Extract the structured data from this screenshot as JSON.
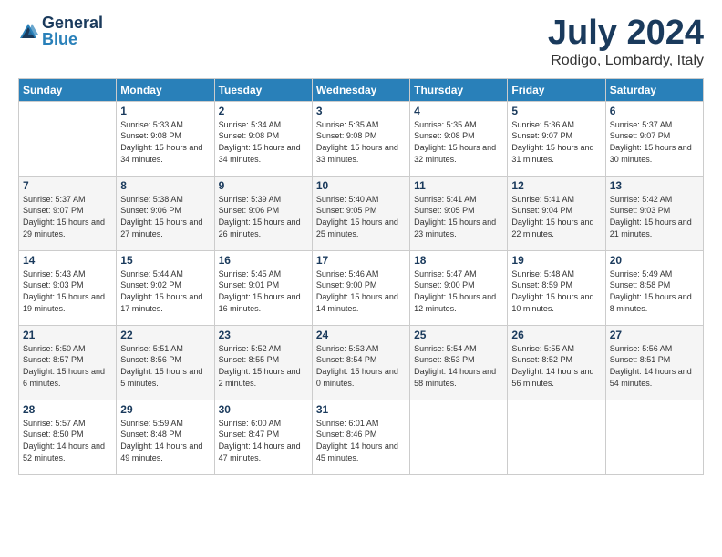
{
  "logo": {
    "general": "General",
    "blue": "Blue"
  },
  "header": {
    "title": "July 2024",
    "subtitle": "Rodigo, Lombardy, Italy"
  },
  "days_of_week": [
    "Sunday",
    "Monday",
    "Tuesday",
    "Wednesday",
    "Thursday",
    "Friday",
    "Saturday"
  ],
  "weeks": [
    [
      {
        "day": "",
        "sunrise": "",
        "sunset": "",
        "daylight": ""
      },
      {
        "day": "1",
        "sunrise": "Sunrise: 5:33 AM",
        "sunset": "Sunset: 9:08 PM",
        "daylight": "Daylight: 15 hours and 34 minutes."
      },
      {
        "day": "2",
        "sunrise": "Sunrise: 5:34 AM",
        "sunset": "Sunset: 9:08 PM",
        "daylight": "Daylight: 15 hours and 34 minutes."
      },
      {
        "day": "3",
        "sunrise": "Sunrise: 5:35 AM",
        "sunset": "Sunset: 9:08 PM",
        "daylight": "Daylight: 15 hours and 33 minutes."
      },
      {
        "day": "4",
        "sunrise": "Sunrise: 5:35 AM",
        "sunset": "Sunset: 9:08 PM",
        "daylight": "Daylight: 15 hours and 32 minutes."
      },
      {
        "day": "5",
        "sunrise": "Sunrise: 5:36 AM",
        "sunset": "Sunset: 9:07 PM",
        "daylight": "Daylight: 15 hours and 31 minutes."
      },
      {
        "day": "6",
        "sunrise": "Sunrise: 5:37 AM",
        "sunset": "Sunset: 9:07 PM",
        "daylight": "Daylight: 15 hours and 30 minutes."
      }
    ],
    [
      {
        "day": "7",
        "sunrise": "Sunrise: 5:37 AM",
        "sunset": "Sunset: 9:07 PM",
        "daylight": "Daylight: 15 hours and 29 minutes."
      },
      {
        "day": "8",
        "sunrise": "Sunrise: 5:38 AM",
        "sunset": "Sunset: 9:06 PM",
        "daylight": "Daylight: 15 hours and 27 minutes."
      },
      {
        "day": "9",
        "sunrise": "Sunrise: 5:39 AM",
        "sunset": "Sunset: 9:06 PM",
        "daylight": "Daylight: 15 hours and 26 minutes."
      },
      {
        "day": "10",
        "sunrise": "Sunrise: 5:40 AM",
        "sunset": "Sunset: 9:05 PM",
        "daylight": "Daylight: 15 hours and 25 minutes."
      },
      {
        "day": "11",
        "sunrise": "Sunrise: 5:41 AM",
        "sunset": "Sunset: 9:05 PM",
        "daylight": "Daylight: 15 hours and 23 minutes."
      },
      {
        "day": "12",
        "sunrise": "Sunrise: 5:41 AM",
        "sunset": "Sunset: 9:04 PM",
        "daylight": "Daylight: 15 hours and 22 minutes."
      },
      {
        "day": "13",
        "sunrise": "Sunrise: 5:42 AM",
        "sunset": "Sunset: 9:03 PM",
        "daylight": "Daylight: 15 hours and 21 minutes."
      }
    ],
    [
      {
        "day": "14",
        "sunrise": "Sunrise: 5:43 AM",
        "sunset": "Sunset: 9:03 PM",
        "daylight": "Daylight: 15 hours and 19 minutes."
      },
      {
        "day": "15",
        "sunrise": "Sunrise: 5:44 AM",
        "sunset": "Sunset: 9:02 PM",
        "daylight": "Daylight: 15 hours and 17 minutes."
      },
      {
        "day": "16",
        "sunrise": "Sunrise: 5:45 AM",
        "sunset": "Sunset: 9:01 PM",
        "daylight": "Daylight: 15 hours and 16 minutes."
      },
      {
        "day": "17",
        "sunrise": "Sunrise: 5:46 AM",
        "sunset": "Sunset: 9:00 PM",
        "daylight": "Daylight: 15 hours and 14 minutes."
      },
      {
        "day": "18",
        "sunrise": "Sunrise: 5:47 AM",
        "sunset": "Sunset: 9:00 PM",
        "daylight": "Daylight: 15 hours and 12 minutes."
      },
      {
        "day": "19",
        "sunrise": "Sunrise: 5:48 AM",
        "sunset": "Sunset: 8:59 PM",
        "daylight": "Daylight: 15 hours and 10 minutes."
      },
      {
        "day": "20",
        "sunrise": "Sunrise: 5:49 AM",
        "sunset": "Sunset: 8:58 PM",
        "daylight": "Daylight: 15 hours and 8 minutes."
      }
    ],
    [
      {
        "day": "21",
        "sunrise": "Sunrise: 5:50 AM",
        "sunset": "Sunset: 8:57 PM",
        "daylight": "Daylight: 15 hours and 6 minutes."
      },
      {
        "day": "22",
        "sunrise": "Sunrise: 5:51 AM",
        "sunset": "Sunset: 8:56 PM",
        "daylight": "Daylight: 15 hours and 5 minutes."
      },
      {
        "day": "23",
        "sunrise": "Sunrise: 5:52 AM",
        "sunset": "Sunset: 8:55 PM",
        "daylight": "Daylight: 15 hours and 2 minutes."
      },
      {
        "day": "24",
        "sunrise": "Sunrise: 5:53 AM",
        "sunset": "Sunset: 8:54 PM",
        "daylight": "Daylight: 15 hours and 0 minutes."
      },
      {
        "day": "25",
        "sunrise": "Sunrise: 5:54 AM",
        "sunset": "Sunset: 8:53 PM",
        "daylight": "Daylight: 14 hours and 58 minutes."
      },
      {
        "day": "26",
        "sunrise": "Sunrise: 5:55 AM",
        "sunset": "Sunset: 8:52 PM",
        "daylight": "Daylight: 14 hours and 56 minutes."
      },
      {
        "day": "27",
        "sunrise": "Sunrise: 5:56 AM",
        "sunset": "Sunset: 8:51 PM",
        "daylight": "Daylight: 14 hours and 54 minutes."
      }
    ],
    [
      {
        "day": "28",
        "sunrise": "Sunrise: 5:57 AM",
        "sunset": "Sunset: 8:50 PM",
        "daylight": "Daylight: 14 hours and 52 minutes."
      },
      {
        "day": "29",
        "sunrise": "Sunrise: 5:59 AM",
        "sunset": "Sunset: 8:48 PM",
        "daylight": "Daylight: 14 hours and 49 minutes."
      },
      {
        "day": "30",
        "sunrise": "Sunrise: 6:00 AM",
        "sunset": "Sunset: 8:47 PM",
        "daylight": "Daylight: 14 hours and 47 minutes."
      },
      {
        "day": "31",
        "sunrise": "Sunrise: 6:01 AM",
        "sunset": "Sunset: 8:46 PM",
        "daylight": "Daylight: 14 hours and 45 minutes."
      },
      {
        "day": "",
        "sunrise": "",
        "sunset": "",
        "daylight": ""
      },
      {
        "day": "",
        "sunrise": "",
        "sunset": "",
        "daylight": ""
      },
      {
        "day": "",
        "sunrise": "",
        "sunset": "",
        "daylight": ""
      }
    ]
  ]
}
